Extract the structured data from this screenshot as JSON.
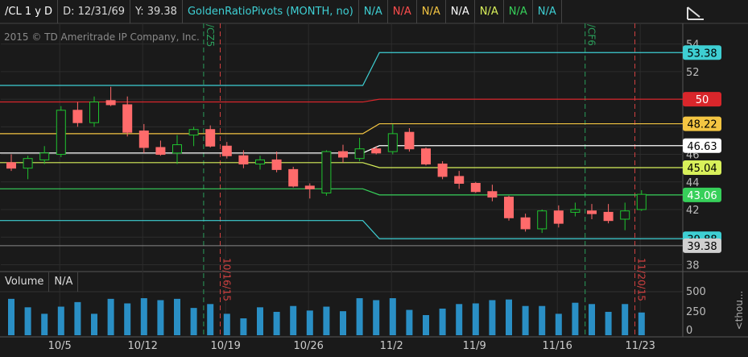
{
  "header": {
    "symbol": "/CL 1 y D",
    "date": "D: 12/31/69",
    "yval": "Y: 39.38",
    "study": "GoldenRatioPivots (MONTH, no)",
    "na_labels": [
      "N/A",
      "N/A",
      "N/A",
      "N/A",
      "N/A",
      "N/A",
      "N/A"
    ],
    "na_colors": [
      "#3ecfd3",
      "#ff4d4d",
      "#f4c542",
      "#ffffff",
      "#d8f05a",
      "#37d05a",
      "#3ecfd3"
    ]
  },
  "copyright": "2015 © TD Ameritrade IP Company, Inc.",
  "volume_panel": {
    "title": "Volume",
    "value": "N/A",
    "axis_unit": "<thou..."
  },
  "icons": [
    "collapse-chart-icon"
  ],
  "colors": {
    "up": "#1fc22f",
    "down": "#ff6b6b",
    "volume": "#2a8fc5",
    "background": "#1a1a1a"
  },
  "chart_data": {
    "type": "candlestick",
    "price_ylim": [
      37.5,
      55.5
    ],
    "price_ticks": [
      38,
      40,
      42,
      44,
      46,
      48,
      50,
      52,
      54
    ],
    "volume_ylim": [
      0,
      620
    ],
    "volume_ticks": [
      "500",
      "250",
      "0"
    ],
    "x_ticks": [
      {
        "label": "10/5",
        "idx": 2
      },
      {
        "label": "10/12",
        "idx": 7
      },
      {
        "label": "10/19",
        "idx": 12
      },
      {
        "label": "10/26",
        "idx": 17
      },
      {
        "label": "11/2",
        "idx": 22
      },
      {
        "label": "11/9",
        "idx": 27
      },
      {
        "label": "11/16",
        "idx": 32
      },
      {
        "label": "11/23",
        "idx": 37
      }
    ],
    "candles": [
      {
        "o": 45.4,
        "h": 46.0,
        "l": 44.8,
        "c": 45.0
      },
      {
        "o": 45.0,
        "h": 45.9,
        "l": 44.2,
        "c": 45.7
      },
      {
        "o": 45.6,
        "h": 46.6,
        "l": 45.3,
        "c": 46.1
      },
      {
        "o": 46.0,
        "h": 49.5,
        "l": 45.8,
        "c": 49.2
      },
      {
        "o": 49.2,
        "h": 49.8,
        "l": 48.0,
        "c": 48.3
      },
      {
        "o": 48.3,
        "h": 50.2,
        "l": 48.0,
        "c": 49.8
      },
      {
        "o": 49.9,
        "h": 50.9,
        "l": 49.5,
        "c": 49.6
      },
      {
        "o": 49.6,
        "h": 50.2,
        "l": 47.3,
        "c": 47.6
      },
      {
        "o": 47.7,
        "h": 48.2,
        "l": 46.1,
        "c": 46.5
      },
      {
        "o": 46.5,
        "h": 47.0,
        "l": 45.9,
        "c": 46.0
      },
      {
        "o": 46.1,
        "h": 47.4,
        "l": 45.3,
        "c": 46.7
      },
      {
        "o": 47.4,
        "h": 48.0,
        "l": 46.6,
        "c": 47.8
      },
      {
        "o": 47.8,
        "h": 48.1,
        "l": 46.5,
        "c": 46.6
      },
      {
        "o": 46.6,
        "h": 46.9,
        "l": 45.7,
        "c": 45.9
      },
      {
        "o": 45.9,
        "h": 46.3,
        "l": 45.0,
        "c": 45.3
      },
      {
        "o": 45.3,
        "h": 45.9,
        "l": 44.9,
        "c": 45.6
      },
      {
        "o": 45.6,
        "h": 46.2,
        "l": 44.7,
        "c": 44.9
      },
      {
        "o": 44.9,
        "h": 45.1,
        "l": 43.6,
        "c": 43.7
      },
      {
        "o": 43.7,
        "h": 43.9,
        "l": 42.8,
        "c": 43.5
      },
      {
        "o": 43.2,
        "h": 46.3,
        "l": 43.0,
        "c": 46.2
      },
      {
        "o": 46.2,
        "h": 46.7,
        "l": 45.4,
        "c": 45.8
      },
      {
        "o": 45.7,
        "h": 47.2,
        "l": 45.5,
        "c": 46.4
      },
      {
        "o": 46.4,
        "h": 46.6,
        "l": 46.0,
        "c": 46.1
      },
      {
        "o": 46.2,
        "h": 48.2,
        "l": 46.0,
        "c": 47.5
      },
      {
        "o": 47.6,
        "h": 47.9,
        "l": 46.2,
        "c": 46.4
      },
      {
        "o": 46.4,
        "h": 46.5,
        "l": 45.2,
        "c": 45.3
      },
      {
        "o": 45.3,
        "h": 45.5,
        "l": 44.2,
        "c": 44.4
      },
      {
        "o": 44.4,
        "h": 44.8,
        "l": 43.5,
        "c": 43.9
      },
      {
        "o": 43.9,
        "h": 44.0,
        "l": 43.2,
        "c": 43.3
      },
      {
        "o": 43.3,
        "h": 43.8,
        "l": 42.6,
        "c": 42.9
      },
      {
        "o": 42.9,
        "h": 43.0,
        "l": 41.2,
        "c": 41.4
      },
      {
        "o": 41.4,
        "h": 41.7,
        "l": 40.4,
        "c": 40.6
      },
      {
        "o": 40.6,
        "h": 42.0,
        "l": 40.3,
        "c": 41.9
      },
      {
        "o": 41.9,
        "h": 42.3,
        "l": 40.7,
        "c": 41.0
      },
      {
        "o": 41.8,
        "h": 42.5,
        "l": 41.5,
        "c": 42.0
      },
      {
        "o": 41.9,
        "h": 42.4,
        "l": 41.3,
        "c": 41.7
      },
      {
        "o": 41.8,
        "h": 42.4,
        "l": 41.0,
        "c": 41.2
      },
      {
        "o": 41.3,
        "h": 42.5,
        "l": 40.5,
        "c": 41.9
      },
      {
        "o": 42.0,
        "h": 43.4,
        "l": 41.9,
        "c": 43.1
      }
    ],
    "volume": [
      560,
      430,
      330,
      440,
      510,
      330,
      560,
      490,
      570,
      540,
      560,
      420,
      480,
      330,
      260,
      430,
      360,
      450,
      380,
      440,
      370,
      570,
      540,
      570,
      390,
      310,
      410,
      480,
      490,
      540,
      550,
      450,
      450,
      330,
      500,
      480,
      360,
      480,
      350
    ],
    "pivot_lines": [
      {
        "name": "R3",
        "color": "#3ecfd3",
        "before": 51.0,
        "after": 53.38,
        "label": "53.38"
      },
      {
        "name": "R2",
        "color": "#d9262b",
        "before": 49.8,
        "after": 50.0,
        "label": "50"
      },
      {
        "name": "R1",
        "color": "#f4c542",
        "before": 47.5,
        "after": 48.22,
        "label": "48.22"
      },
      {
        "name": "PP",
        "color": "#ffffff",
        "before": 46.1,
        "after": 46.63,
        "label": "46.63"
      },
      {
        "name": "S1",
        "color": "#d8f05a",
        "before": 45.4,
        "after": 45.04,
        "label": "45.04"
      },
      {
        "name": "S2",
        "color": "#37d05a",
        "before": 43.5,
        "after": 43.06,
        "label": "43.06"
      },
      {
        "name": "S3",
        "color": "#3ecfd3",
        "before": 41.2,
        "after": 39.88,
        "label": "39.88"
      }
    ],
    "price_bubble": {
      "value": "39.38",
      "color": "#d0d0d0"
    },
    "event_markers": [
      {
        "idx": 11.5,
        "text": "/CZ5",
        "color": "#2a9d5a"
      },
      {
        "idx": 12.5,
        "text": "10/16/15",
        "color": "#d04040"
      },
      {
        "idx": 34.5,
        "text": "/CF6",
        "color": "#2a9d5a"
      },
      {
        "idx": 37.5,
        "text": "11/20/15",
        "color": "#d04040"
      }
    ]
  }
}
